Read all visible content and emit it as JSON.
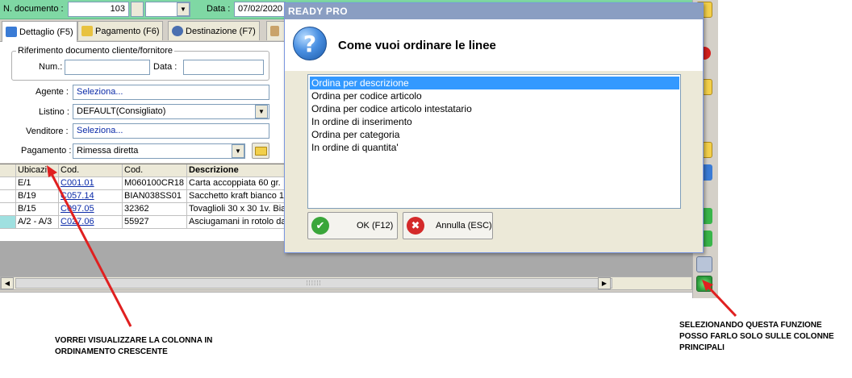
{
  "header": {
    "doc_number_label": "N. documento :",
    "doc_number_value": "103",
    "date_label": "Data :",
    "date_value": "07/02/2020"
  },
  "tabs": [
    {
      "label": "Dettaglio (F5)",
      "active": true
    },
    {
      "label": "Pagamento (F6)",
      "active": false
    },
    {
      "label": "Destinazione (F7)",
      "active": false
    }
  ],
  "reference_group": {
    "title": "Riferimento documento cliente/fornitore",
    "num_label": "Num.:",
    "num_value": "",
    "date_label": "Data :",
    "date_value": ""
  },
  "form": {
    "agente_label": "Agente :",
    "agente_value": "Seleziona...",
    "listino_label": "Listino :",
    "listino_value": "DEFAULT(Consigliato)",
    "venditore_label": "Venditore :",
    "venditore_value": "Seleziona...",
    "pagamento_label": "Pagamento :",
    "pagamento_value": "Rimessa diretta"
  },
  "grid": {
    "columns": [
      "Ubicazi...",
      "Cod.",
      "Cod.",
      "Descrizione"
    ],
    "rows": [
      [
        "E/1",
        "C001.01",
        "M060100CR18",
        "Carta accoppiata 60 gr."
      ],
      [
        "B/19",
        "C057.14",
        "BIAN038SS01",
        "Sacchetto kraft bianco 1"
      ],
      [
        "B/15",
        "C097.05",
        "32362",
        "Tovaglioli 30 x 30 1v. Bia"
      ],
      [
        "A/2 - A/3",
        "C027.06",
        "55927",
        "Asciugamani in rotolo da"
      ]
    ]
  },
  "dialog": {
    "title": "READY PRO",
    "question": "Come vuoi ordinare le linee",
    "options": [
      "Ordina per descrizione",
      "Ordina per codice articolo",
      "Ordina per codice articolo intestatario",
      "In ordine di inserimento",
      "Ordina per categoria",
      "In ordine di quantita'"
    ],
    "selected_index": 0,
    "ok_label": "OK (F12)",
    "cancel_label": "Annulla (ESC)"
  },
  "annotations": {
    "left_note": "VORREI VISUALIZZARE LA COLONNA IN\nORDINAMENTO CRESCENTE",
    "right_note": "SELEZIONANDO QUESTA FUNZIONE\nPOSSO FARLO SOLO SULLE COLONNE\nPRINCIPALI"
  },
  "colors": {
    "topbar": "#7fd8a4",
    "dialog_title": "#8a9ec2",
    "selection": "#3399ff",
    "arrow": "#e02020"
  }
}
